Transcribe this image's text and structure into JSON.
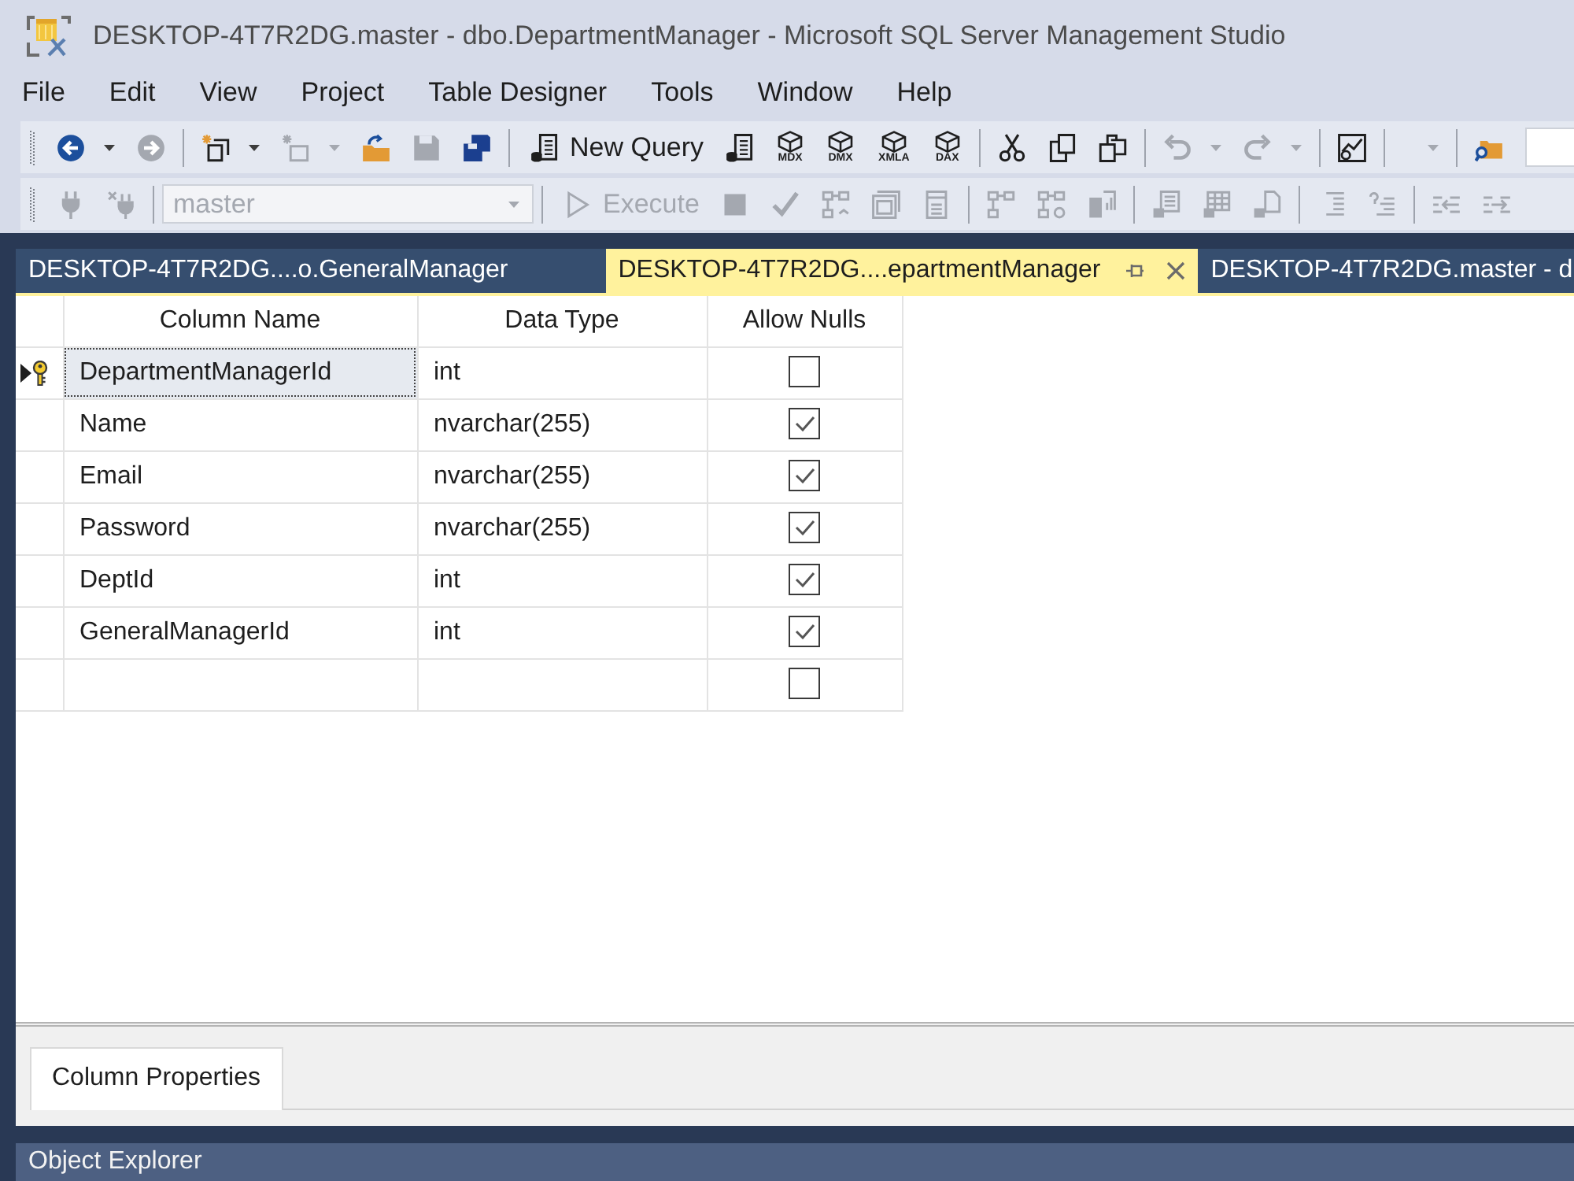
{
  "window": {
    "title": "DESKTOP-4T7R2DG.master - dbo.DepartmentManager - Microsoft SQL Server Management Studio"
  },
  "menu": [
    "File",
    "Edit",
    "View",
    "Project",
    "Table Designer",
    "Tools",
    "Window",
    "Help"
  ],
  "toolbars": [
    {
      "groups": [
        {
          "items": [
            {
              "kind": "button",
              "disabled": false,
              "dropdown": true
            },
            {
              "kind": "button",
              "disabled": true
            }
          ]
        },
        {
          "items": [
            {
              "kind": "button",
              "disabled": false,
              "dropdown": true
            },
            {
              "kind": "button",
              "disabled": true,
              "dropdown": true
            },
            {
              "kind": "button",
              "disabled": false
            },
            {
              "kind": "button",
              "disabled": true
            },
            {
              "kind": "button",
              "disabled": false
            }
          ]
        },
        {
          "items": [
            {
              "kind": "button",
              "label": "New Query",
              "disabled": false
            },
            {
              "kind": "button",
              "disabled": false
            },
            {
              "kind": "button",
              "tag": "MDX",
              "disabled": false
            },
            {
              "kind": "button",
              "tag": "DMX",
              "disabled": false
            },
            {
              "kind": "button",
              "tag": "XMLA",
              "disabled": false
            },
            {
              "kind": "button",
              "tag": "DAX",
              "disabled": false
            }
          ]
        },
        {
          "items": [
            {
              "kind": "button",
              "disabled": false
            },
            {
              "kind": "button",
              "disabled": false
            },
            {
              "kind": "button",
              "disabled": false
            }
          ]
        },
        {
          "items": [
            {
              "kind": "button",
              "disabled": true,
              "dropdown": true
            },
            {
              "kind": "button",
              "disabled": true,
              "dropdown": true
            }
          ]
        },
        {
          "items": [
            {
              "kind": "button",
              "disabled": false
            }
          ]
        },
        {
          "items": [
            {
              "kind": "dropdown",
              "disabled": true
            }
          ]
        },
        {
          "items": [
            {
              "kind": "button",
              "disabled": false
            },
            {
              "kind": "search"
            }
          ]
        }
      ]
    },
    {
      "groups": [
        {
          "items": [
            {
              "kind": "button",
              "disabled": true
            },
            {
              "kind": "button",
              "disabled": true
            }
          ]
        },
        {
          "items": [
            {
              "kind": "combo",
              "value": "master",
              "disabled": true
            }
          ]
        },
        {
          "items": [
            {
              "kind": "button",
              "label": "Execute",
              "disabled": true
            },
            {
              "kind": "button",
              "disabled": true
            },
            {
              "kind": "button",
              "disabled": true
            },
            {
              "kind": "button",
              "disabled": true
            },
            {
              "kind": "button",
              "disabled": true
            },
            {
              "kind": "button",
              "disabled": true
            }
          ]
        },
        {
          "items": [
            {
              "kind": "button",
              "disabled": true
            },
            {
              "kind": "button",
              "disabled": true
            },
            {
              "kind": "button",
              "disabled": true
            }
          ]
        },
        {
          "items": [
            {
              "kind": "button",
              "disabled": true
            },
            {
              "kind": "button",
              "disabled": true
            },
            {
              "kind": "button",
              "disabled": true
            }
          ]
        },
        {
          "items": [
            {
              "kind": "button",
              "disabled": true
            },
            {
              "kind": "button",
              "disabled": true
            }
          ]
        },
        {
          "items": [
            {
              "kind": "button",
              "disabled": true
            },
            {
              "kind": "button",
              "disabled": true
            }
          ]
        }
      ]
    }
  ],
  "document_tabs": [
    {
      "label": "DESKTOP-4T7R2DG....o.GeneralManager",
      "selected": false
    },
    {
      "label": "DESKTOP-4T7R2DG....epartmentManager",
      "selected": true
    },
    {
      "label": "DESKTOP-4T7R2DG.master - d",
      "selected": false
    }
  ],
  "table_designer": {
    "columns": [
      "Column Name",
      "Data Type",
      "Allow Nulls"
    ],
    "rows": [
      {
        "column_name": "DepartmentManagerId",
        "data_type": "int",
        "allow_nulls": false,
        "primary_key": true,
        "selected": true
      },
      {
        "column_name": "Name",
        "data_type": "nvarchar(255)",
        "allow_nulls": true,
        "primary_key": false,
        "selected": false
      },
      {
        "column_name": "Email",
        "data_type": "nvarchar(255)",
        "allow_nulls": true,
        "primary_key": false,
        "selected": false
      },
      {
        "column_name": "Password",
        "data_type": "nvarchar(255)",
        "allow_nulls": true,
        "primary_key": false,
        "selected": false
      },
      {
        "column_name": "DeptId",
        "data_type": "int",
        "allow_nulls": true,
        "primary_key": false,
        "selected": false
      },
      {
        "column_name": "GeneralManagerId",
        "data_type": "int",
        "allow_nulls": true,
        "primary_key": false,
        "selected": false
      },
      {
        "allow_nulls": false,
        "primary_key": false,
        "selected": false
      }
    ]
  },
  "properties_panel": {
    "tabs": [
      {
        "label": "Column Properties",
        "selected": true
      }
    ]
  },
  "object_explorer": {
    "title": "Object Explorer"
  }
}
